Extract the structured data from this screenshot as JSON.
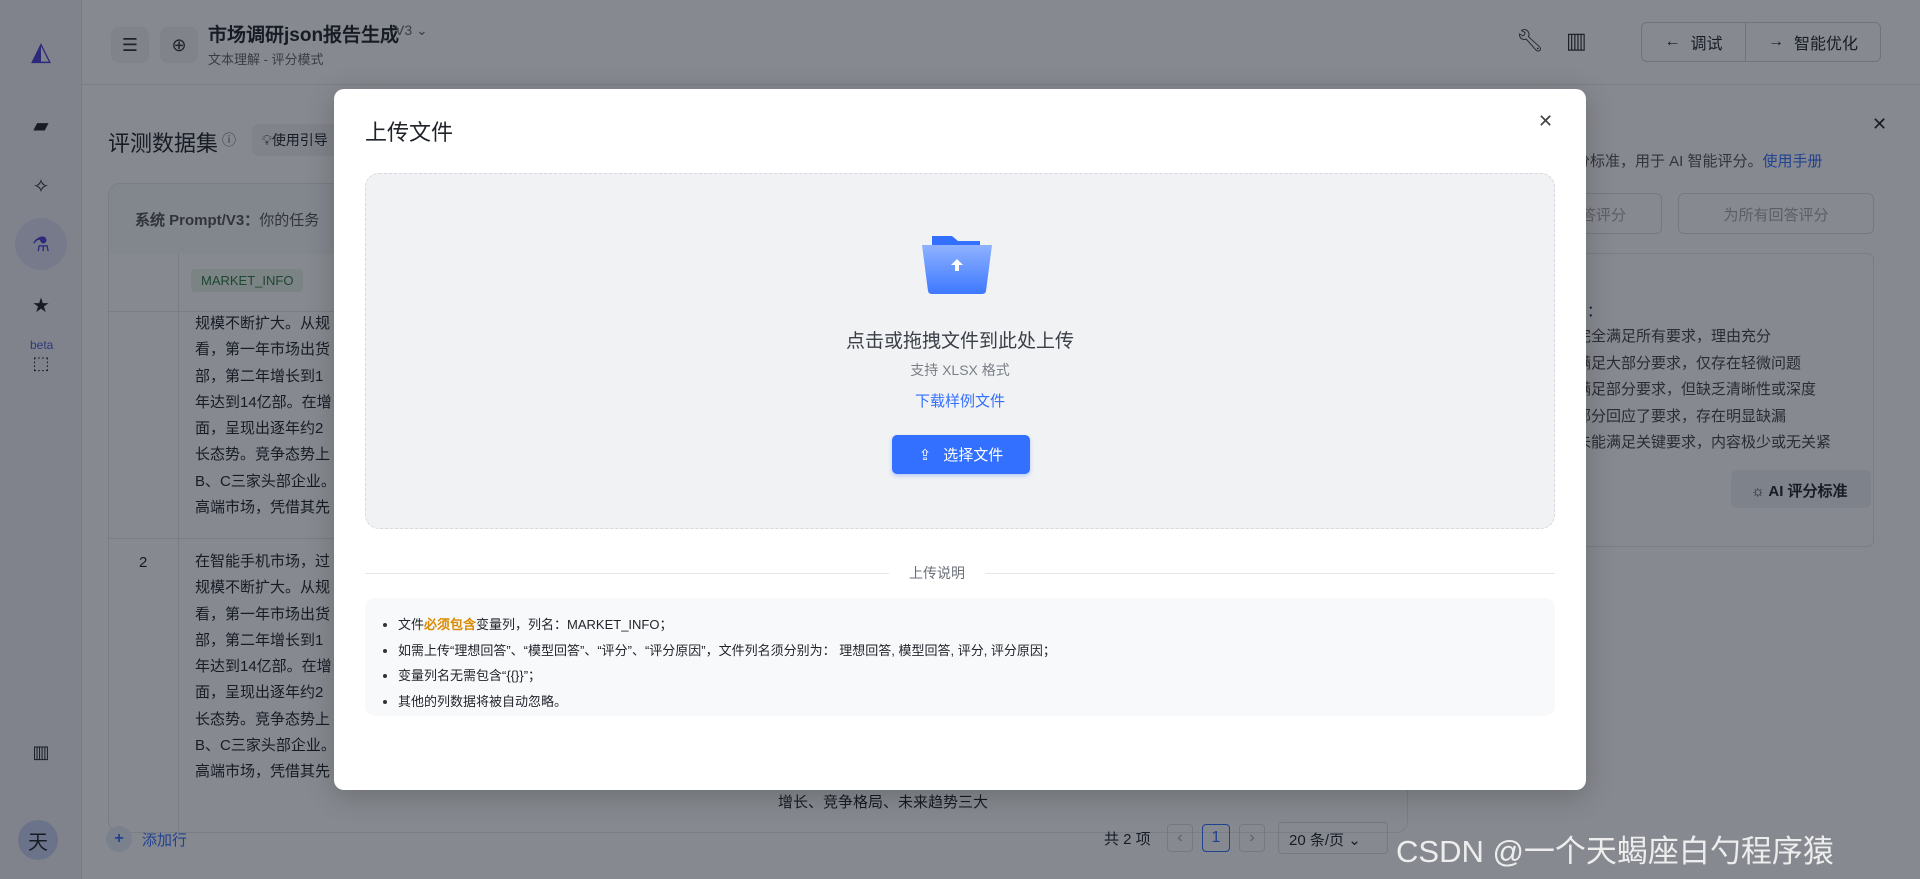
{
  "header": {
    "title": "市场调研json报告生成",
    "version": "V3",
    "subtitle": "文本理解 - 评分模式",
    "debug": "调试",
    "optimize": "智能优化"
  },
  "sidebar": {
    "beta": "beta",
    "avatar": "天"
  },
  "main": {
    "heading": "评测数据集",
    "guide": "使用引导",
    "prompt_label": "系统 Prompt/V3：",
    "prompt_text": "你的任务",
    "column_tag": "MARKET_INFO",
    "row1_lines": [
      "规模不断扩大。从规",
      "看，第一年市场出货",
      "部，第二年增长到1",
      "年达到14亿部。在增",
      "面，呈现出逐年约2",
      "长态势。竞争态势上",
      "B、C三家头部企业。",
      "高端市场，凭借其先"
    ],
    "row2_index": "2",
    "row2_lines": [
      "在智能手机市场，过",
      "规模不断扩大。从规",
      "看，第一年市场出货",
      "部，第二年增长到1",
      "年达到14亿部。在增",
      "面，呈现出逐年约2",
      "长态势。竞争态势上",
      "B、C三家头部企业。",
      "高端市场，凭借其先"
    ],
    "bottom_cell": "增长、竞争格局、未来趋势三大",
    "add_row": "添加行",
    "pagination": {
      "total": "共 2 项",
      "current": "1",
      "page_size": "20 条/页"
    }
  },
  "right_panel": {
    "desc": "评分标准，用于 AI 智能评分。",
    "manual": "使用手册",
    "btn_one": "答评分",
    "btn_all": "为所有回答评分",
    "colon": "：",
    "criteria": [
      "答完全满足所有要求，理由充分",
      "答满足大部分要求，仅存在轻微问题",
      "答满足部分要求，但缺乏清晰性或深度",
      "答部分回应了要求，存在明显缺漏",
      "答未能满足关键要求，内容极少或无关紧"
    ],
    "ai_btn": "AI 评分标准"
  },
  "modal": {
    "title": "上传文件",
    "drop_text": "点击或拖拽文件到此处上传",
    "format": "支持 XLSX 格式",
    "sample_link": "下载样例文件",
    "choose": "选择文件",
    "notes_title": "上传说明",
    "note1_pre": "文件",
    "note1_hl": "必须包含",
    "note1_post": "变量列，列名：MARKET_INFO；",
    "note2": "如需上传“理想回答”、“模型回答”、“评分”、“评分原因”，文件列名须分别为： 理想回答, 模型回答, 评分, 评分原因；",
    "note3": "变量列名无需包含“{{}}”；",
    "note4": "其他的列数据将被自动忽略。"
  },
  "watermark": "CSDN @一个天蝎座白勺程序猿",
  "colors": {
    "primary": "#3370ff",
    "highlight": "#d98a00",
    "brand": "#4c3fd6"
  }
}
